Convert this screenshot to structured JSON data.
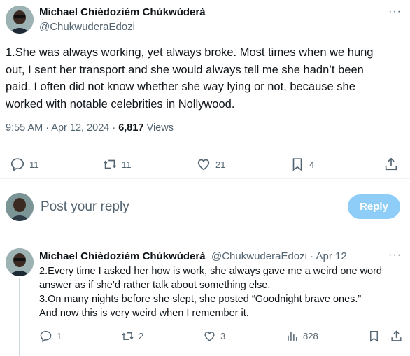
{
  "tweet": {
    "author_name": "Michael Chièdoziém Chúkwúderà",
    "author_handle": "@ChukwuderaEdozi",
    "more_icon": "more-icon",
    "text_lines": [
      "1.She was always working, yet always broke. Most times when we hung",
      "out, I sent her transport and she would always tell me she hadn’t been",
      "paid. I often did not know whether she way lying or not, because she",
      "worked with notable celebrities in Nollywood."
    ],
    "time": "9:55 AM · Apr 12, 2024 · ",
    "views_count": "6,817",
    "views_label": " Views",
    "actions": {
      "replies": "11",
      "retweets": "11",
      "likes": "21",
      "bookmarks": "4"
    }
  },
  "composer": {
    "placeholder": "Post your reply",
    "button_label": "Reply"
  },
  "reply": {
    "author_name": "Michael Chièdoziém Chúkwúderà",
    "author_handle": "@ChukwuderaEdozi",
    "date": " · Apr 12",
    "text_lines": [
      "2.Every time I asked her how is work, she always gave me a weird one word",
      "answer as if she’d rather talk about something else.",
      "3.On many nights before she slept, she posted “Goodnight brave ones.”",
      "And now this is very weird when I remember it."
    ],
    "actions": {
      "replies": "1",
      "retweets": "2",
      "likes": "3",
      "views": "828"
    }
  },
  "colors": {
    "text": "#0f1419",
    "muted": "#536471",
    "reply_button": "#8ecdf8",
    "divider": "#eff3f4"
  }
}
